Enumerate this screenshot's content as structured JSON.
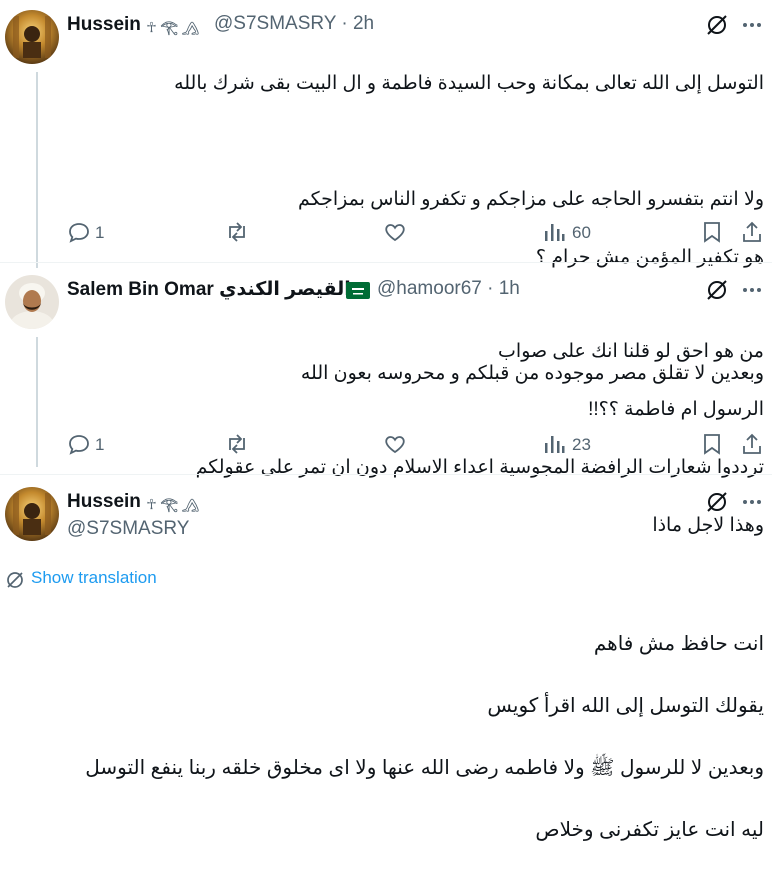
{
  "tweets": [
    {
      "name": "Hussein",
      "name_glyphs": "☥ 𓂀 𓂻",
      "handle": "@S7SMASRY",
      "time": "2h",
      "lines": [
        "التوسل إلى الله تعالى بمكانة وحب السيدة فاطمة  و ال البيت بقى شرك بالله",
        "",
        "ولا انتم بتفسرو الحاجه على مزاجكم و تكفرو الناس بمزاجكم",
        "هو تكفير المؤمن مش حرام ؟",
        "",
        "وبعدين لا تقلق مصر موجوده من قبلكم و محروسه بعون الله"
      ],
      "replies": "1",
      "views": "60"
    },
    {
      "name": "Salem Bin Omar القيصر الكندي",
      "handle": "@hamoor67",
      "time": "1h",
      "lines": [
        "من هو احق لو قلنا انك على صواب",
        "الرسول ام فاطمة ؟؟!!",
        "ترددوا شعارات الرافضة المجوسية اعداء الاسلام دون ان تمر على عقولكم",
        "وهذا لاجل ماذا"
      ],
      "replies": "1",
      "views": "23"
    },
    {
      "name": "Hussein",
      "name_glyphs": "☥ 𓂀 𓂻",
      "handle": "@S7SMASRY",
      "translate": "Show translation",
      "lines": [
        "انت حافظ مش فاهم",
        "يقولك التوسل إلى الله اقرأ كويس",
        "وبعدين لا للرسول ﷺ  ولا فاطمه رضى الله عنها ولا اى  مخلوق خلقه ربنا ينفع التوسل",
        "ليه انت عايز تكفرنى وخلاص"
      ]
    }
  ],
  "separator": "·",
  "colors": {
    "text": "#0f1419",
    "muted": "#536471",
    "link": "#1d9bf0",
    "line": "#cfd9de"
  },
  "icons": [
    "reply-icon",
    "retweet-icon",
    "like-icon",
    "views-icon",
    "bookmark-icon",
    "share-icon",
    "grok-icon",
    "more-icon",
    "translate-icon",
    "saudi-flag-icon"
  ]
}
